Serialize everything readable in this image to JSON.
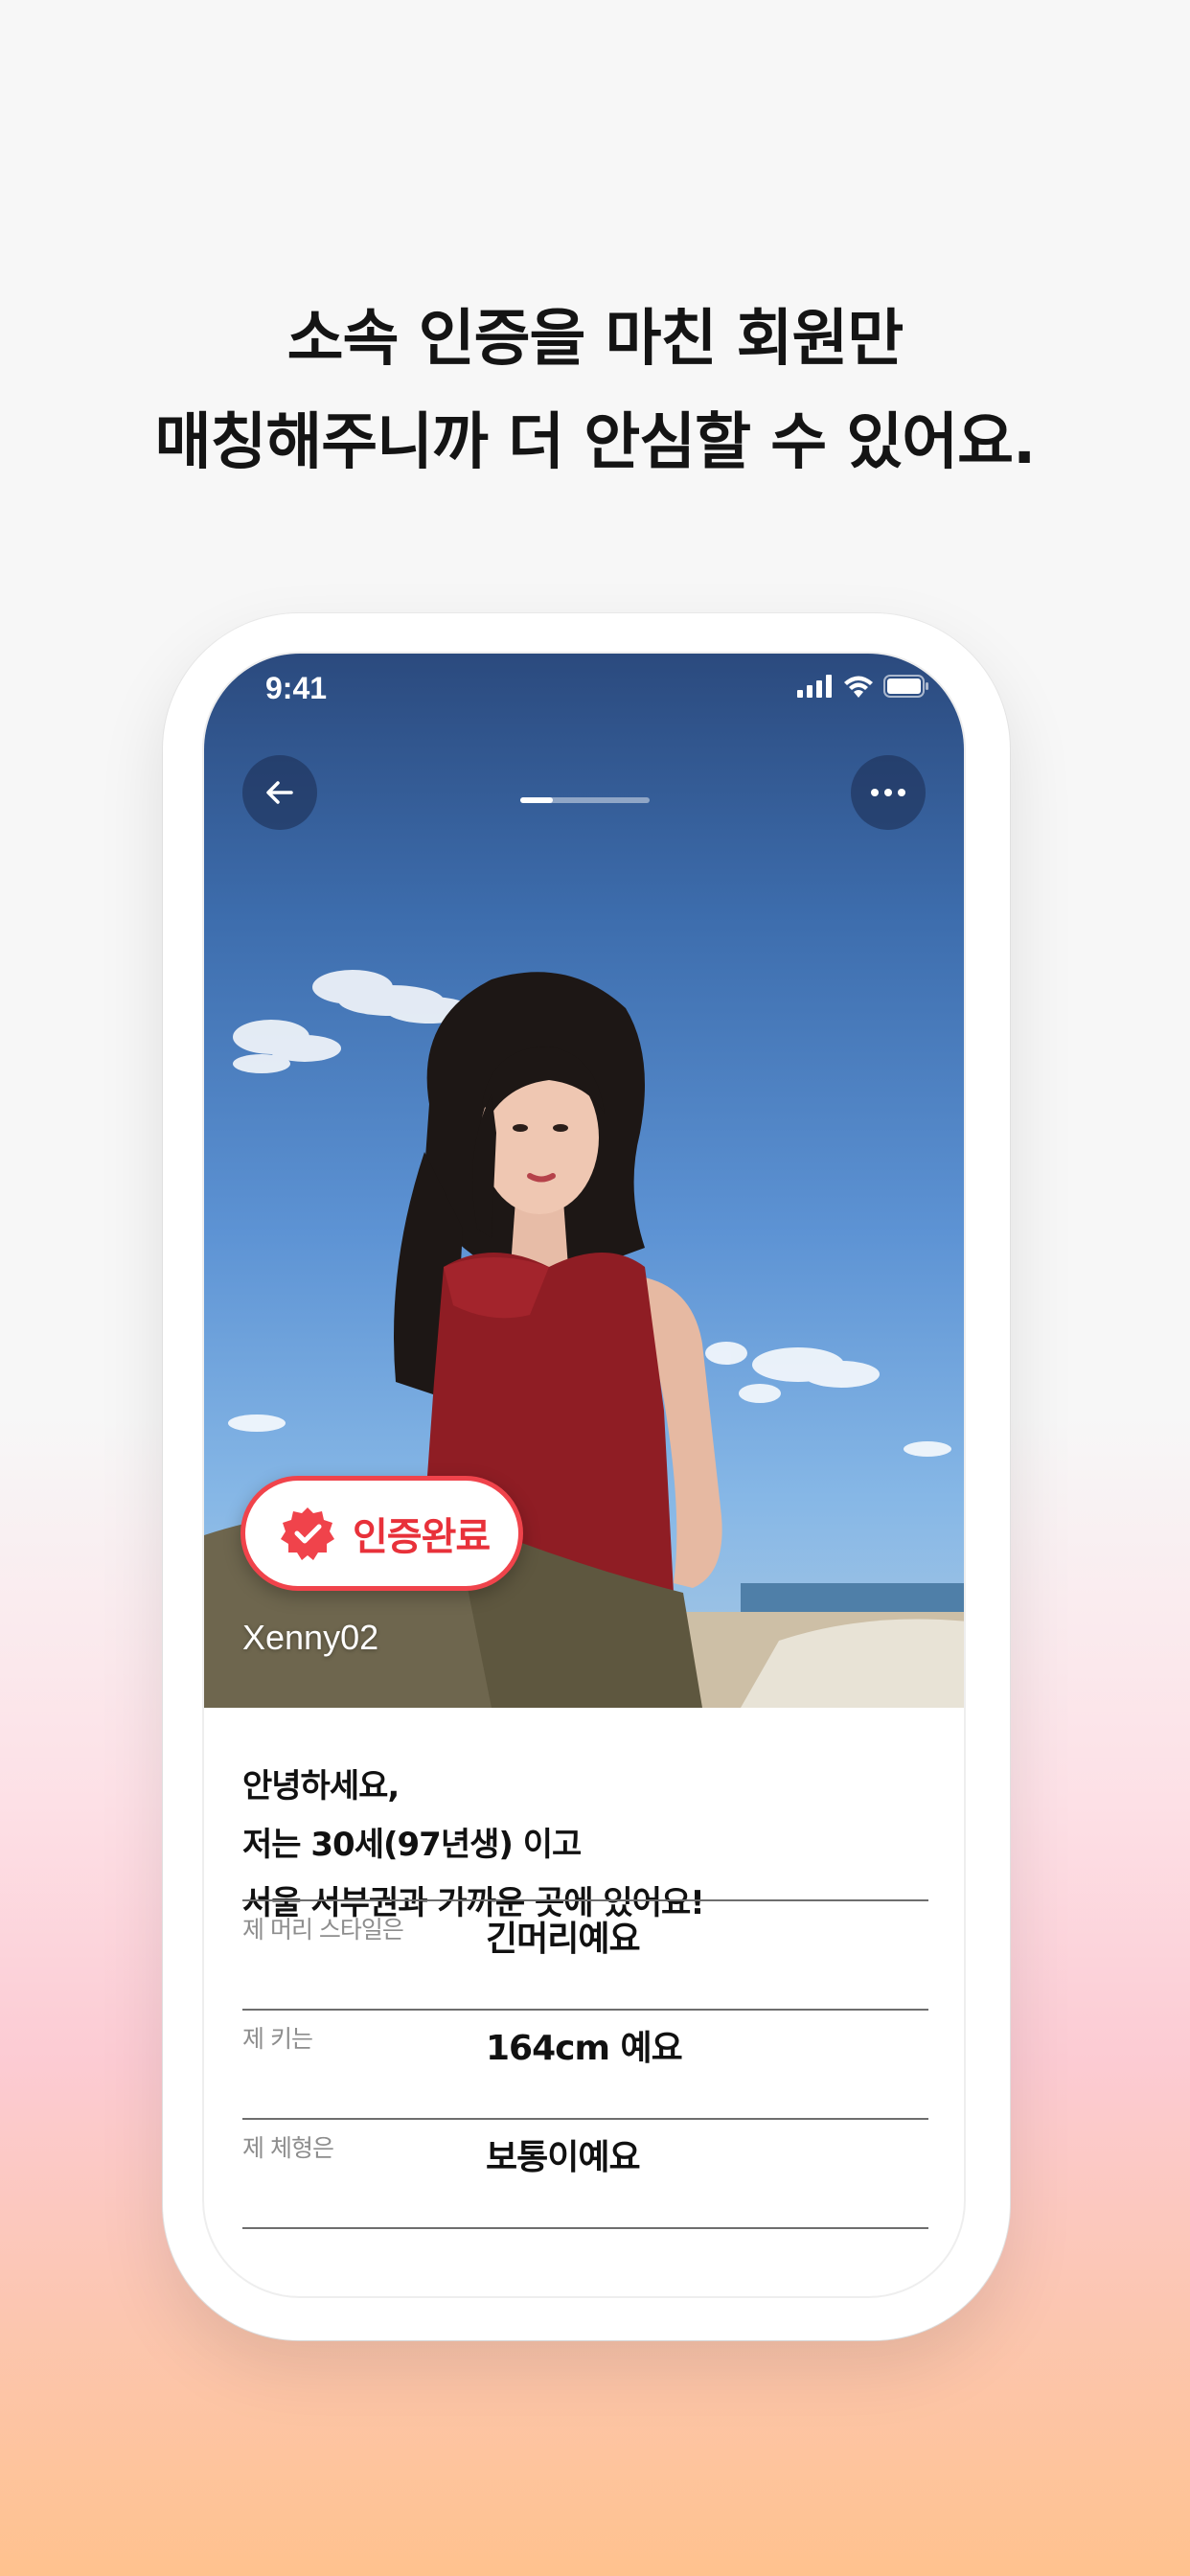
{
  "headline": {
    "line1": "소속 인증을 마친 회원만",
    "line2": "매칭해주니까 더 안심할 수 있어요."
  },
  "status_bar": {
    "time": "9:41",
    "icons": [
      "signal-icon",
      "wifi-icon",
      "battery-icon"
    ]
  },
  "profile": {
    "photo_progress": 0.25,
    "verified_label": "인증완료",
    "username": "Xenny02",
    "intro": [
      "안녕하세요,",
      "저는 30세(97년생) 이고",
      "서울 서부권과 가까운 곳에 있어요!"
    ],
    "attributes": [
      {
        "label": "제 머리 스타일은",
        "value": "긴머리예요"
      },
      {
        "label": "제 키는",
        "value": "164cm 예요"
      },
      {
        "label": "제 체형은",
        "value": "보통이예요"
      }
    ]
  },
  "colors": {
    "accent": "#f0434b",
    "headline": "#141414",
    "sky": "#3d6dad"
  }
}
